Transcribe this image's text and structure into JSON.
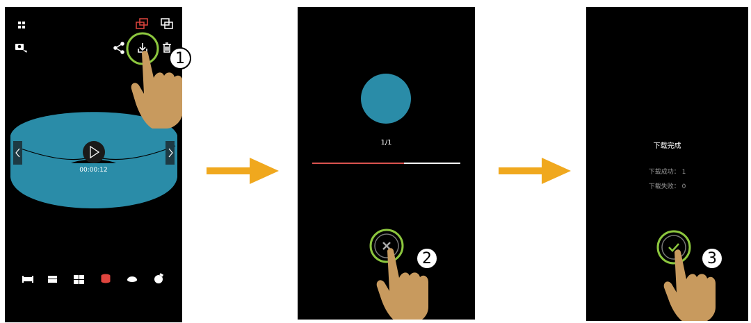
{
  "step1": {
    "timecode": "00:00:12",
    "badge": "1",
    "icons": [
      "grid-icon",
      "phone-switch-icon",
      "camera-icon",
      "share-icon",
      "download-icon",
      "delete-icon",
      "play-icon",
      "prev-arrow-icon",
      "next-arrow-icon"
    ],
    "mode_icons": [
      "single-view-icon",
      "dual-view-icon",
      "quad-view-icon",
      "cylinder-view-icon",
      "bowl-view-icon",
      "ball-view-icon"
    ]
  },
  "step2": {
    "progress_text": "1/1",
    "progress": 0.62,
    "badge": "2",
    "icons": [
      "cancel-icon"
    ]
  },
  "step3": {
    "title": "下载完成",
    "success": "下载成功：  1",
    "fail": "下载失败：  0",
    "badge": "3",
    "icons": [
      "confirm-icon"
    ]
  },
  "colors": {
    "accent_teal": "#2a8ca8",
    "ring_green": "#8cc63e",
    "arrow_orange": "#f0a81e",
    "progress_red": "#d9534f",
    "active_red": "#e0453e"
  }
}
